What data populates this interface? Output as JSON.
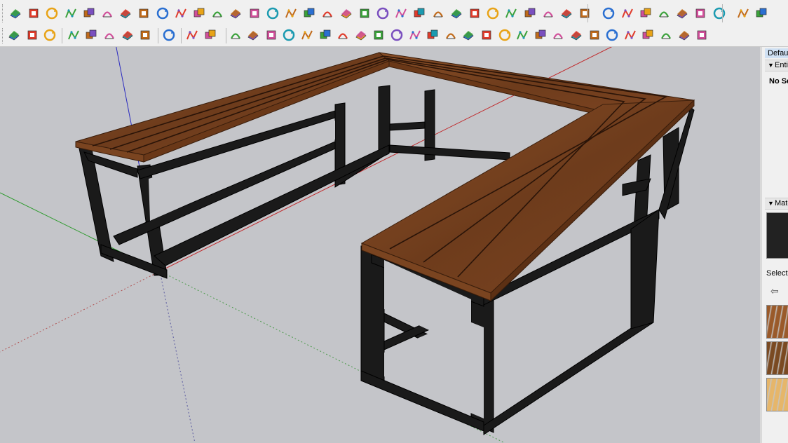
{
  "toolbar_top": {
    "icons": [
      "layer-blue-icon",
      "layer-blue-flat-icon",
      "layer-yellow-icon",
      "layer-green-icon",
      "layer-red-icon",
      "layer-white-icon",
      "rotate-orange-icon",
      "red-square-icon",
      "list-icon",
      "flag-icon",
      "dog-icon",
      "link-icon",
      "corner-icon",
      "red-dots-path-icon",
      "red-cross-icon",
      "green-tree-icon",
      "blue-x-icon",
      "flask-icon",
      "triangle-warning-icon",
      "arc-icon",
      "fire-icon",
      "circular-arrow-icon",
      "four-arrows-icon",
      "cup-icon",
      "red-arc-icon",
      "green-leaf-icon",
      "cube-arrow-icon",
      "red-cubes-icon",
      "cube-edit-icon",
      "gem-icon",
      "flower-icon",
      "frame-icon",
      "orange-grid-icon",
      "grid-yellow-icon",
      "grid-orange-icon",
      "red-x-dots-icon",
      "dotted-arc-icon",
      "grid-blue-icon",
      "box-tool-icon",
      "box-stack-icon",
      "box-square-icon"
    ]
  },
  "toolbar_bottom": {
    "icons": [
      "curve-e-icon",
      "refresh-icon",
      "swap-icon",
      "add-circle-icon",
      "tree-icon",
      "quarter-pie-icon",
      "checker-sphere-icon",
      "cloud-upload-icon",
      "gear-icon",
      "mail-icon",
      "info-icon",
      "bezier-icon",
      "red-curve-icon",
      "paint-bucket-icon",
      "scissors-icon",
      "gear-wheel-icon",
      "sun-shape-icon",
      "box-ring-icon",
      "sphere-cut-icon",
      "split-arrows-icon",
      "loop-icon",
      "red-bend-icon",
      "pipe-icon",
      "lathe-icon",
      "columns-icon",
      "stripes-icon",
      "hand-icon",
      "shape-icon",
      "shelf-icon",
      "steps-icon",
      "sweep-icon",
      "zigzag-icon",
      "flow-icon",
      "stamp-icon",
      "lens-icon",
      "wedge-icon",
      "pipe-bend-icon",
      "vertical-bars-icon"
    ]
  },
  "tray": {
    "title": "Default Tray",
    "entity_info_header": "Entity Info",
    "entity_info_text": "No Selection",
    "materials_header": "Materials",
    "current_material_color": "#222222",
    "select_tab": "Select",
    "swatches": [
      "#9a5a2a",
      "#7a4a22",
      "#e6b66a"
    ]
  },
  "scene": {
    "wood_color": "#6b3a1c",
    "steel_color": "#1a1a1a",
    "background_color": "#c4c5c9",
    "axis_red": "#c0282a",
    "axis_green": "#2a9a2a",
    "axis_blue": "#2a2ac0"
  }
}
